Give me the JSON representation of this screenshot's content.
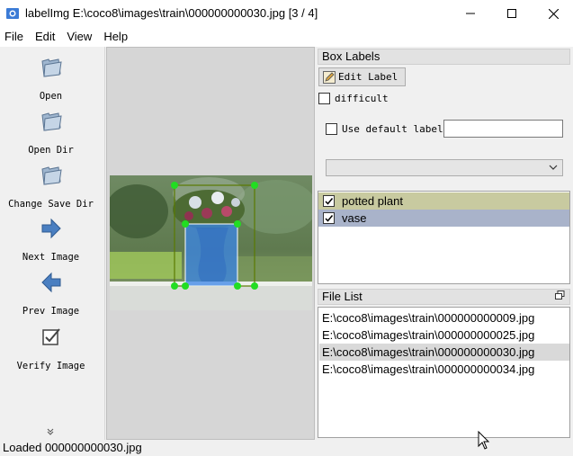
{
  "window": {
    "title": "labelImg E:\\coco8\\images\\train\\000000000030.jpg [3 / 4]",
    "controls": [
      "minimize-icon",
      "maximize-icon",
      "close-icon"
    ]
  },
  "menu": [
    "File",
    "Edit",
    "View",
    "Help"
  ],
  "toolbar": {
    "items": [
      {
        "label": "Open",
        "icon": "folder-open-icon"
      },
      {
        "label": "Open Dir",
        "icon": "folder-open-icon"
      },
      {
        "label": "Change Save Dir",
        "icon": "folder-open-icon"
      },
      {
        "label": "Next Image",
        "icon": "arrow-right-icon"
      },
      {
        "label": "Prev Image",
        "icon": "arrow-left-icon"
      },
      {
        "label": "Verify Image",
        "icon": "checkbox-icon"
      }
    ],
    "more": "»"
  },
  "box_labels": {
    "header": "Box Labels",
    "edit_label": "Edit Label",
    "difficult": "difficult",
    "use_default_label": "Use default label",
    "default_label_value": "",
    "combo_value": ""
  },
  "labels": [
    {
      "text": "potted plant",
      "checked": true,
      "color": "#c8caa0"
    },
    {
      "text": "vase",
      "checked": true,
      "color": "#a9b3ca"
    }
  ],
  "file_list": {
    "header": "File List",
    "files": [
      "E:\\coco8\\images\\train\\000000000009.jpg",
      "E:\\coco8\\images\\train\\000000000025.jpg",
      "E:\\coco8\\images\\train\\000000000030.jpg",
      "E:\\coco8\\images\\train\\000000000034.jpg"
    ],
    "selected_index": 2
  },
  "status": "Loaded 000000000030.jpg",
  "colors": {
    "handle": "#22dd22",
    "vase_box_fill": "#3a86e8",
    "plant_box_stroke": "#5a7a00"
  }
}
